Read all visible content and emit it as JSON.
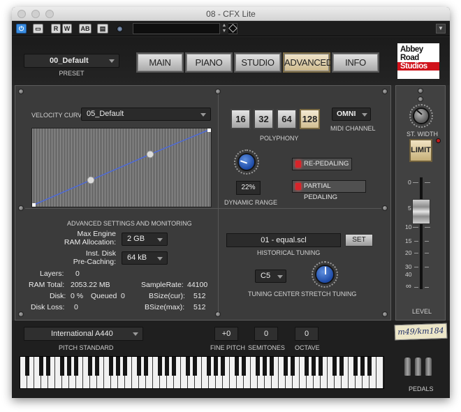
{
  "window": {
    "title": "08 - CFX Lite"
  },
  "toolbar": {
    "btn_r": "R",
    "btn_w": "W",
    "btn_ab": "AB"
  },
  "preset": {
    "value": "00_Default",
    "label": "PRESET"
  },
  "tabs": [
    {
      "label": "MAIN"
    },
    {
      "label": "PIANO"
    },
    {
      "label": "STUDIO"
    },
    {
      "label": "ADVANCED",
      "active": true
    },
    {
      "label": "INFO"
    }
  ],
  "logo": {
    "line1": "Abbey",
    "line2": "Road",
    "line3": "Studios"
  },
  "velocity": {
    "label": "VELOCITY CURVE",
    "value": "05_Default"
  },
  "polyphony": {
    "options": [
      "16",
      "32",
      "64",
      "128"
    ],
    "selected": "128",
    "label": "POLYPHONY"
  },
  "midi": {
    "value": "OMNI",
    "label": "MIDI CHANNEL"
  },
  "dynamic_range": {
    "value": "22%",
    "label": "DYNAMIC RANGE"
  },
  "re_pedaling": {
    "label": "RE-PEDALING"
  },
  "partial_pedaling": {
    "label": "PARTIAL PEDALING"
  },
  "advanced": {
    "title": "ADVANCED SETTINGS AND MONITORING",
    "max_engine_l1": "Max Engine",
    "max_engine_l2": "RAM Allocation:",
    "max_engine_value": "2 GB",
    "inst_disk_l1": "Inst. Disk",
    "inst_disk_l2": "Pre-Caching:",
    "inst_disk_value": "64 kB",
    "layers_label": "Layers:",
    "layers_value": "0",
    "ram_total_label": "RAM Total:",
    "ram_total_value": "2053.22 MB",
    "disk_label": "Disk:",
    "disk_value": "0 %",
    "queued_label": "Queued",
    "queued_value": "0",
    "disk_loss_label": "Disk Loss:",
    "disk_loss_value": "0",
    "samplerate_label": "SampleRate:",
    "samplerate_value": "44100",
    "bsize_cur_label": "BSize(cur):",
    "bsize_cur_value": "512",
    "bsize_max_label": "BSize(max):",
    "bsize_max_value": "512"
  },
  "tuning": {
    "value": "01 - equal.scl",
    "set_label": "SET",
    "label": "HISTORICAL TUNING",
    "center_value": "C5",
    "center_label": "TUNING CENTER",
    "stretch_label": "STRETCH TUNING"
  },
  "side": {
    "st_width_label": "ST. WIDTH",
    "limit_label": "LIMIT",
    "scale": [
      "0",
      "5",
      "10",
      "15",
      "20",
      "30",
      "40",
      "∞"
    ],
    "level_label": "LEVEL"
  },
  "bottom": {
    "pitch_value": "International  A440",
    "pitch_label": "PITCH STANDARD",
    "fine_pitch_value": "+0",
    "fine_pitch_label": "FINE PITCH",
    "semitones_value": "0",
    "semitones_label": "SEMITONES",
    "octave_value": "0",
    "octave_label": "OCTAVE",
    "signature": "m49/km184",
    "pedals_label": "PEDALS"
  },
  "colors": {
    "accent": "#d4c192",
    "led": "#d8242a",
    "knob": "#2a5bc2"
  },
  "icons": [
    "power-icon",
    "window-icon",
    "dropdown-caret-icon",
    "screw-icon",
    "led-icon",
    "knob-icon"
  ]
}
